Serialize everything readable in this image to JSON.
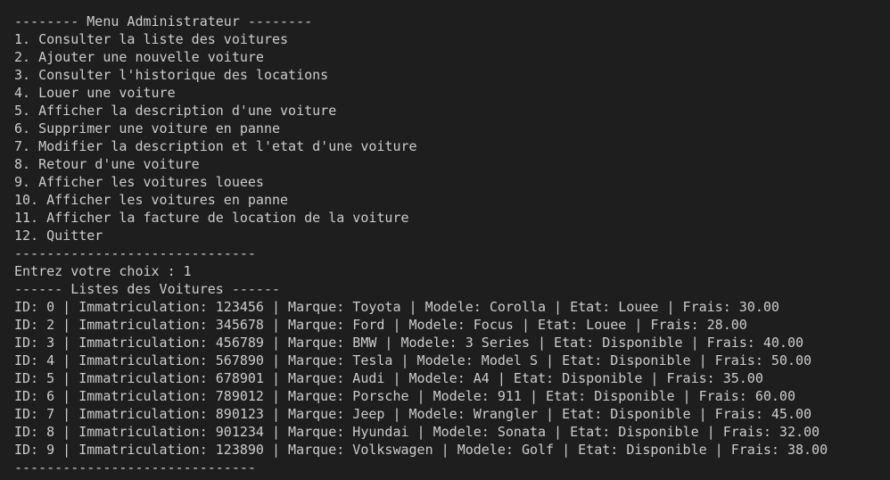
{
  "terminal": {
    "colors": {
      "background": "#1e1e1e",
      "foreground": "#cccccc"
    },
    "lines": [
      "-------- Menu Administrateur --------",
      "1. Consulter la liste des voitures",
      "2. Ajouter une nouvelle voiture",
      "3. Consulter l'historique des locations",
      "4. Louer une voiture",
      "5. Afficher la description d'une voiture",
      "6. Supprimer une voiture en panne",
      "7. Modifier la description et l'etat d'une voiture",
      "8. Retour d'une voiture",
      "9. Afficher les voitures louees",
      "10. Afficher les voitures en panne",
      "11. Afficher la facture de location de la voiture",
      "12. Quitter",
      "------------------------------",
      "Entrez votre choix : 1",
      "------ Listes des Voitures ------",
      "ID: 0 | Immatriculation: 123456 | Marque: Toyota | Modele: Corolla | Etat: Louee | Frais: 30.00",
      "ID: 2 | Immatriculation: 345678 | Marque: Ford | Modele: Focus | Etat: Louee | Frais: 28.00",
      "ID: 3 | Immatriculation: 456789 | Marque: BMW | Modele: 3 Series | Etat: Disponible | Frais: 40.00",
      "ID: 4 | Immatriculation: 567890 | Marque: Tesla | Modele: Model S | Etat: Disponible | Frais: 50.00",
      "ID: 5 | Immatriculation: 678901 | Marque: Audi | Modele: A4 | Etat: Disponible | Frais: 35.00",
      "ID: 6 | Immatriculation: 789012 | Marque: Porsche | Modele: 911 | Etat: Disponible | Frais: 60.00",
      "ID: 7 | Immatriculation: 890123 | Marque: Jeep | Modele: Wrangler | Etat: Disponible | Frais: 45.00",
      "ID: 8 | Immatriculation: 901234 | Marque: Hyundai | Modele: Sonata | Etat: Disponible | Frais: 32.00",
      "ID: 9 | Immatriculation: 123890 | Marque: Volkswagen | Modele: Golf | Etat: Disponible | Frais: 38.00",
      "------------------------------"
    ]
  }
}
